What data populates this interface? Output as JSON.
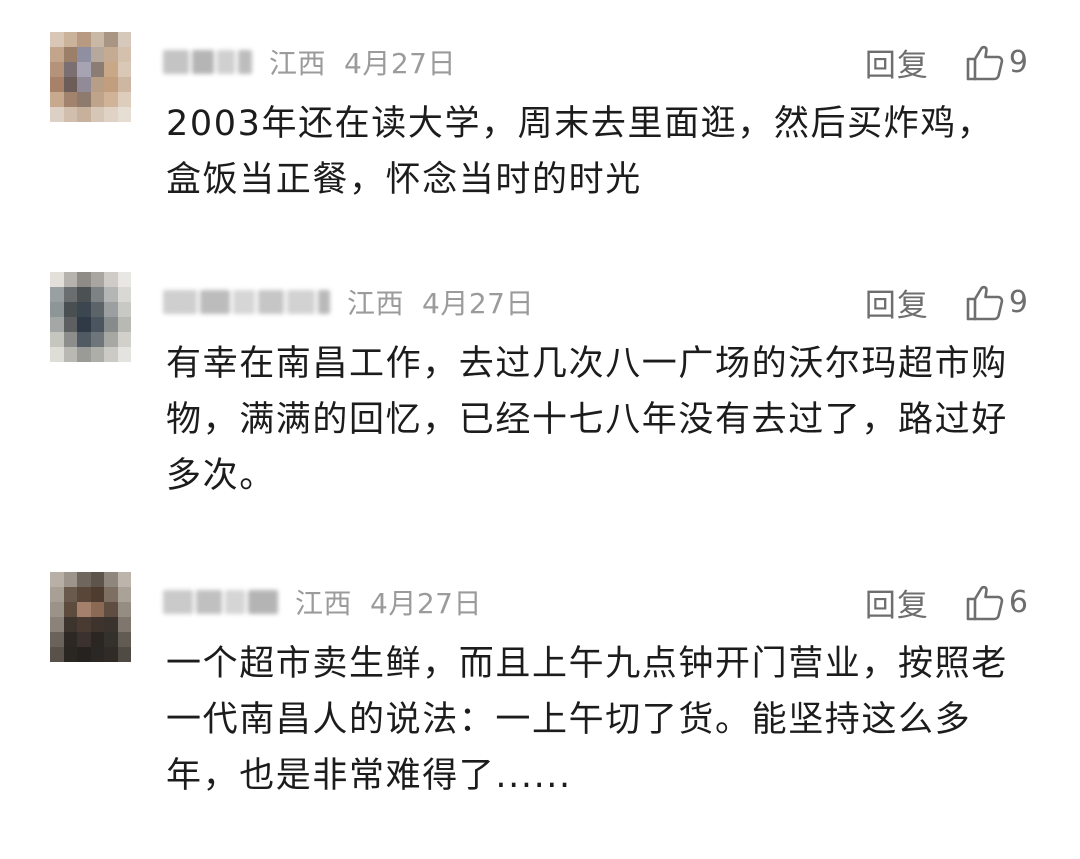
{
  "comments": [
    {
      "location": "江西",
      "date": "4月27日",
      "reply_label": "回复",
      "like_icon": "thumbs-up-icon",
      "likes": "9",
      "text": "2003年还在读大学，周末去里面逛，然后买炸鸡，盒饭当正餐，怀念当时的时光"
    },
    {
      "location": "江西",
      "date": "4月27日",
      "reply_label": "回复",
      "like_icon": "thumbs-up-icon",
      "likes": "9",
      "text": "有幸在南昌工作，去过几次八一广场的沃尔玛超市购物，满满的回忆，已经十七八年没有去过了，路过好多次。"
    },
    {
      "location": "江西",
      "date": "4月27日",
      "reply_label": "回复",
      "like_icon": "thumbs-up-icon",
      "likes": "6",
      "text": "一个超市卖生鲜，而且上午九点钟开门营业，按照老一代南昌人的说法：一上午切了货。能坚持这么多年，也是非常难得了......"
    }
  ]
}
